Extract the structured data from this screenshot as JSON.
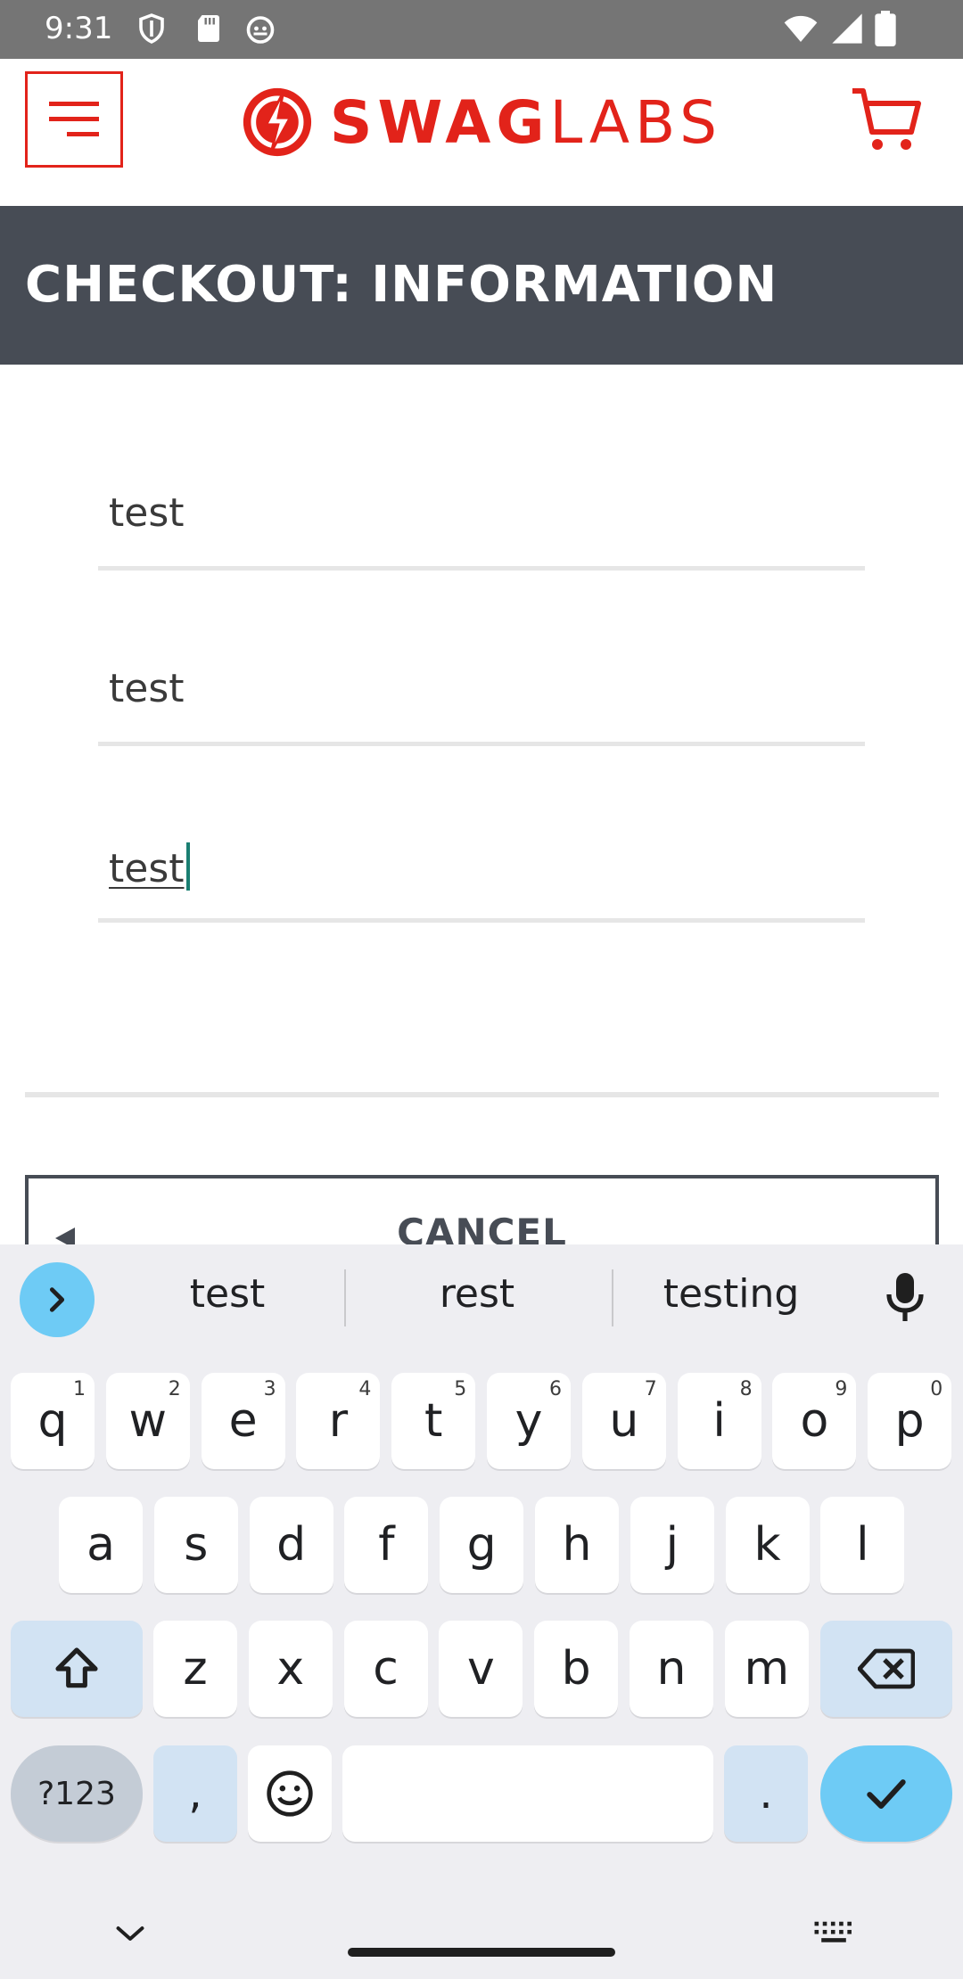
{
  "status_bar": {
    "time": "9:31",
    "left_icons": [
      "shield-icon",
      "sd-card-icon",
      "android-icon"
    ],
    "right_icons": [
      "wifi-icon",
      "signal-icon",
      "battery-icon"
    ]
  },
  "header": {
    "logo_bold": "SWAG",
    "logo_thin": "LABS",
    "brand_color": "#e2231a"
  },
  "banner": {
    "title": "CHECKOUT: INFORMATION",
    "background": "#474c55"
  },
  "form": {
    "first_name": "test",
    "last_name": "test",
    "postal_code": "test"
  },
  "actions": {
    "cancel_label": "CANCEL"
  },
  "keyboard": {
    "suggestions": [
      "test",
      "rest",
      "testing"
    ],
    "row1": [
      {
        "k": "q",
        "h": "1"
      },
      {
        "k": "w",
        "h": "2"
      },
      {
        "k": "e",
        "h": "3"
      },
      {
        "k": "r",
        "h": "4"
      },
      {
        "k": "t",
        "h": "5"
      },
      {
        "k": "y",
        "h": "6"
      },
      {
        "k": "u",
        "h": "7"
      },
      {
        "k": "i",
        "h": "8"
      },
      {
        "k": "o",
        "h": "9"
      },
      {
        "k": "p",
        "h": "0"
      }
    ],
    "row2": [
      "a",
      "s",
      "d",
      "f",
      "g",
      "h",
      "j",
      "k",
      "l"
    ],
    "row3": [
      "z",
      "x",
      "c",
      "v",
      "b",
      "n",
      "m"
    ],
    "symbols_label": "?123",
    "comma_label": ",",
    "period_label": ".",
    "accent_color": "#6ecbf5"
  }
}
